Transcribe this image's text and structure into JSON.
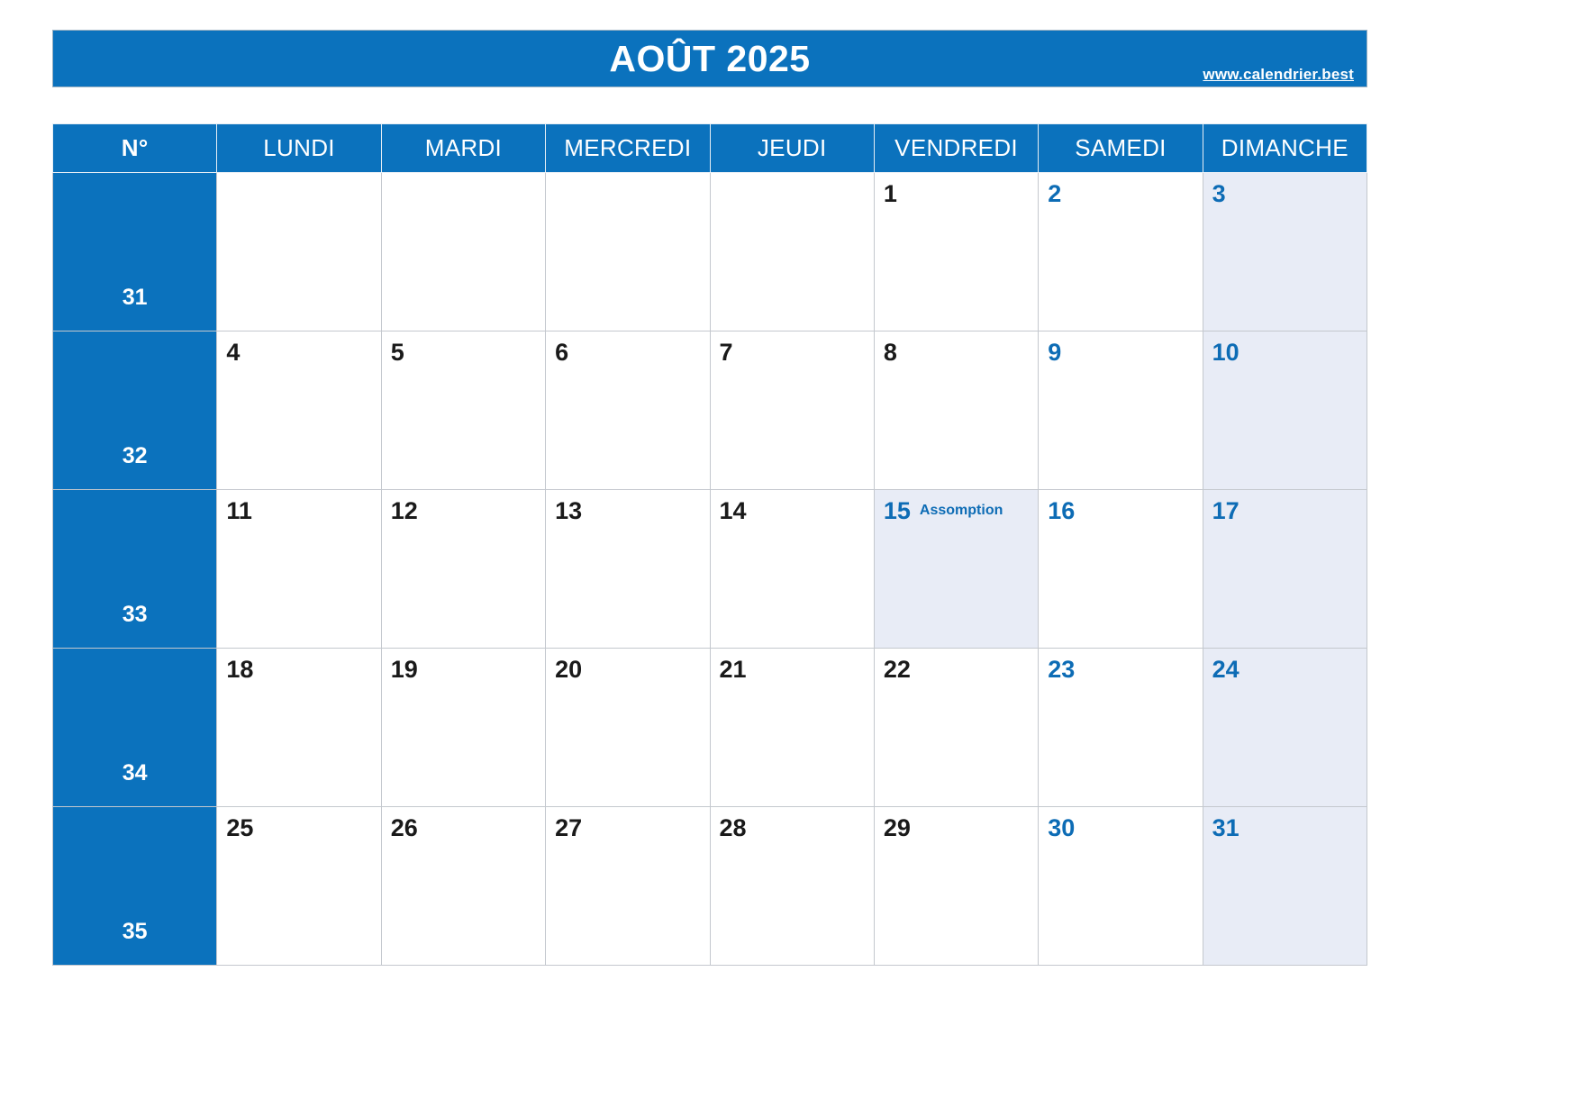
{
  "header": {
    "month_title": "AOÛT 2025",
    "site_url": "www.calendrier.best",
    "accent_color": "#0b72bd",
    "weekend_bg_color": "#e8ecf6",
    "weekend_text_color": "#0d6cb5",
    "weekday_text_color": "#1a1a1a"
  },
  "columns": [
    {
      "key": "wk",
      "label": "N°"
    },
    {
      "key": "mon",
      "label": "LUNDI"
    },
    {
      "key": "tue",
      "label": "MARDI"
    },
    {
      "key": "wed",
      "label": "MERCREDI"
    },
    {
      "key": "thu",
      "label": "JEUDI"
    },
    {
      "key": "fri",
      "label": "VENDREDI"
    },
    {
      "key": "sat",
      "label": "SAMEDI"
    },
    {
      "key": "sun",
      "label": "DIMANCHE"
    }
  ],
  "weeks": [
    {
      "number": "31",
      "days": [
        {
          "num": "",
          "event": ""
        },
        {
          "num": "",
          "event": ""
        },
        {
          "num": "",
          "event": ""
        },
        {
          "num": "",
          "event": ""
        },
        {
          "num": "1",
          "event": ""
        },
        {
          "num": "2",
          "event": ""
        },
        {
          "num": "3",
          "event": ""
        }
      ]
    },
    {
      "number": "32",
      "days": [
        {
          "num": "4",
          "event": ""
        },
        {
          "num": "5",
          "event": ""
        },
        {
          "num": "6",
          "event": ""
        },
        {
          "num": "7",
          "event": ""
        },
        {
          "num": "8",
          "event": ""
        },
        {
          "num": "9",
          "event": ""
        },
        {
          "num": "10",
          "event": ""
        }
      ]
    },
    {
      "number": "33",
      "days": [
        {
          "num": "11",
          "event": ""
        },
        {
          "num": "12",
          "event": ""
        },
        {
          "num": "13",
          "event": ""
        },
        {
          "num": "14",
          "event": ""
        },
        {
          "num": "15",
          "event": "Assomption"
        },
        {
          "num": "16",
          "event": ""
        },
        {
          "num": "17",
          "event": ""
        }
      ]
    },
    {
      "number": "34",
      "days": [
        {
          "num": "18",
          "event": ""
        },
        {
          "num": "19",
          "event": ""
        },
        {
          "num": "20",
          "event": ""
        },
        {
          "num": "21",
          "event": ""
        },
        {
          "num": "22",
          "event": ""
        },
        {
          "num": "23",
          "event": ""
        },
        {
          "num": "24",
          "event": ""
        }
      ]
    },
    {
      "number": "35",
      "days": [
        {
          "num": "25",
          "event": ""
        },
        {
          "num": "26",
          "event": ""
        },
        {
          "num": "27",
          "event": ""
        },
        {
          "num": "28",
          "event": ""
        },
        {
          "num": "29",
          "event": ""
        },
        {
          "num": "30",
          "event": ""
        },
        {
          "num": "31",
          "event": ""
        }
      ]
    }
  ]
}
